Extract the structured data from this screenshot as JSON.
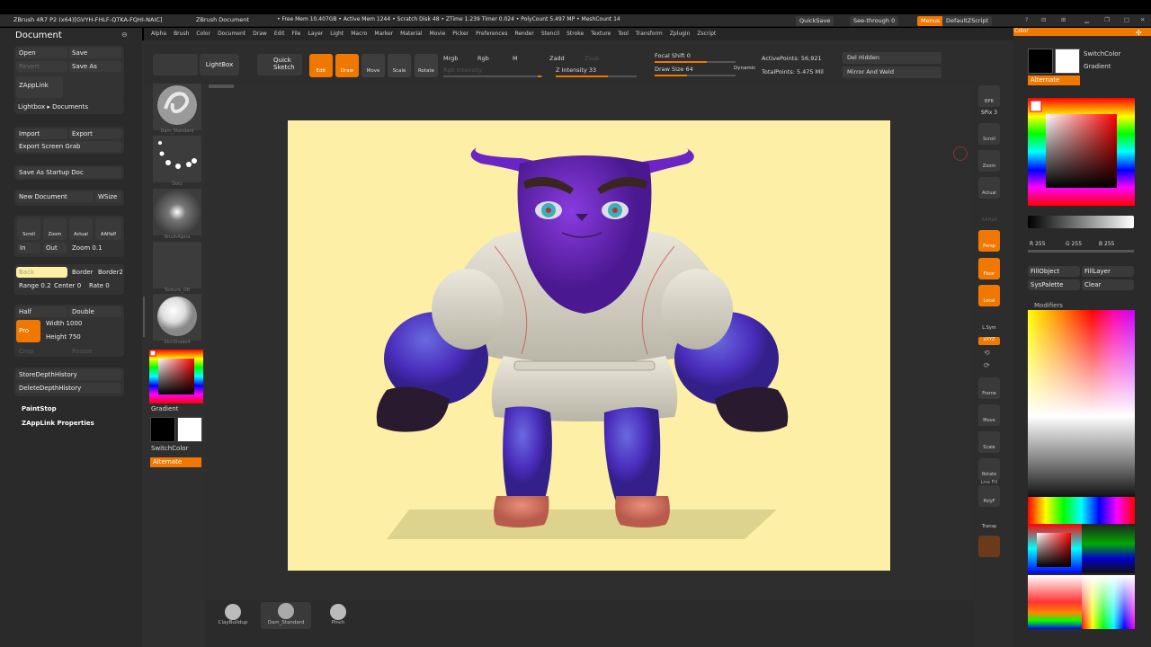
{
  "titlebar": {
    "app": "ZBrush 4R7 P2 (x64)[GVYH-FHLF-QTKA-FQHI-NAIC]",
    "document": "ZBrush Document",
    "stats": "• Free Mem 10.407GB • Active Mem 1244 • Scratch Disk 48 • ZTime 1.239 Timer 0.024 • PolyCount 5.497 MP • MeshCount 14",
    "quicksave": "QuickSave",
    "seethrough": "See-through  0",
    "menus": "Menus",
    "script": "DefaultZScript"
  },
  "menubar": [
    "Alpha",
    "Brush",
    "Color",
    "Document",
    "Draw",
    "Edit",
    "File",
    "Layer",
    "Light",
    "Macro",
    "Marker",
    "Material",
    "Movie",
    "Picker",
    "Preferences",
    "Render",
    "Stencil",
    "Stroke",
    "Texture",
    "Tool",
    "Transform",
    "Zplugin",
    "Zscript"
  ],
  "left": {
    "title": "Document",
    "open": "Open",
    "save": "Save",
    "revert": "Revert",
    "save_as": "Save As",
    "zapplink": "ZAppLink",
    "lightbox_docs": "Lightbox ▸ Documents",
    "import": "Import",
    "export": "Export",
    "export_screen": "Export Screen Grab",
    "save_startup": "Save As Startup Doc",
    "new_doc": "New Document",
    "wsize": "WSize",
    "scroll": "Scroll",
    "zoom": "Zoom",
    "actual": "Actual",
    "aahalf": "AAHalf",
    "in": "In",
    "out": "Out",
    "zoom_val": "Zoom 0.1",
    "back": "Back",
    "border": "Border",
    "border2": "Border2",
    "range": "Range 0.2",
    "center": "Center 0",
    "rate": "Rate 0",
    "half": "Half",
    "double": "Double",
    "pro": "Pro",
    "width": "Width 1000",
    "height": "Height 750",
    "crop": "Crop",
    "resize": "Resize",
    "store_depth": "StoreDepthHistory",
    "delete_depth": "DeleteDepthHistory",
    "paintstop": "PaintStop",
    "zapplink_props": "ZAppLink Properties"
  },
  "shelf": {
    "projection_master": "Projection Master",
    "lightbox": "LightBox",
    "brush1": "Dam_Standard",
    "brush2": "Dots",
    "brush3": "BrushAlpha",
    "brush4": "Texture_Off",
    "brush5": "SkinShade4",
    "gradient": "Gradient",
    "switchcolor": "SwitchColor",
    "alternate": "Alternate"
  },
  "toolbar": {
    "quick_sketch": "Quick Sketch",
    "edit": "Edit",
    "draw": "Draw",
    "move": "Move",
    "scale": "Scale",
    "rotate": "Rotate",
    "mrgb": "Mrgb",
    "rgb": "Rgb",
    "m": "M",
    "zadd": "Zadd",
    "zsub": "Zsub",
    "rgb_intensity": "Rgb Intensity",
    "z_intensity": "Z Intensity 33",
    "focal_shift": "Focal Shift 0",
    "draw_size": "Draw Size 64",
    "dynamic": "Dynamic",
    "active_points": "ActivePoints: 56,921",
    "total_points": "TotalPoints: 5.475 Mil",
    "del_hidden": "Del Hidden",
    "mirror_weld": "Mirror And Weld"
  },
  "rightstrip": {
    "bpr": "BPR",
    "spix": "SPix 3",
    "scroll": "Scroll",
    "zoom": "Zoom",
    "actual": "Actual",
    "aahalf": "AAHalf",
    "persp": "Persp",
    "floor": "Floor",
    "local": "Local",
    "lsym": "L.Sym",
    "xyz": "xXYZ",
    "frame": "Frame",
    "move": "Move",
    "scale": "Scale",
    "rotate": "Rotate",
    "line_fill": "Line Fill",
    "polyf": "PolyF",
    "transp": "Transp"
  },
  "rightpanel": {
    "header": "Color",
    "switchcolor": "SwitchColor",
    "gradient": "Gradient",
    "alternate": "Alternate",
    "r": "R 255",
    "g": "G 255",
    "b": "B 255",
    "fillobject": "FillObject",
    "filllayer": "FillLayer",
    "syspalette": "SysPalette",
    "clear": "Clear",
    "modifiers": "Modifiers"
  },
  "bottom": {
    "brush1": "ClayBuildup",
    "brush2": "Dam_Standard",
    "brush3": "Pinch"
  },
  "colors": {
    "accent": "#f07800",
    "canvas_bg": "#fdf0a6",
    "creature_purple": "#6a2bb8",
    "uniform": "#d9d5c8"
  }
}
